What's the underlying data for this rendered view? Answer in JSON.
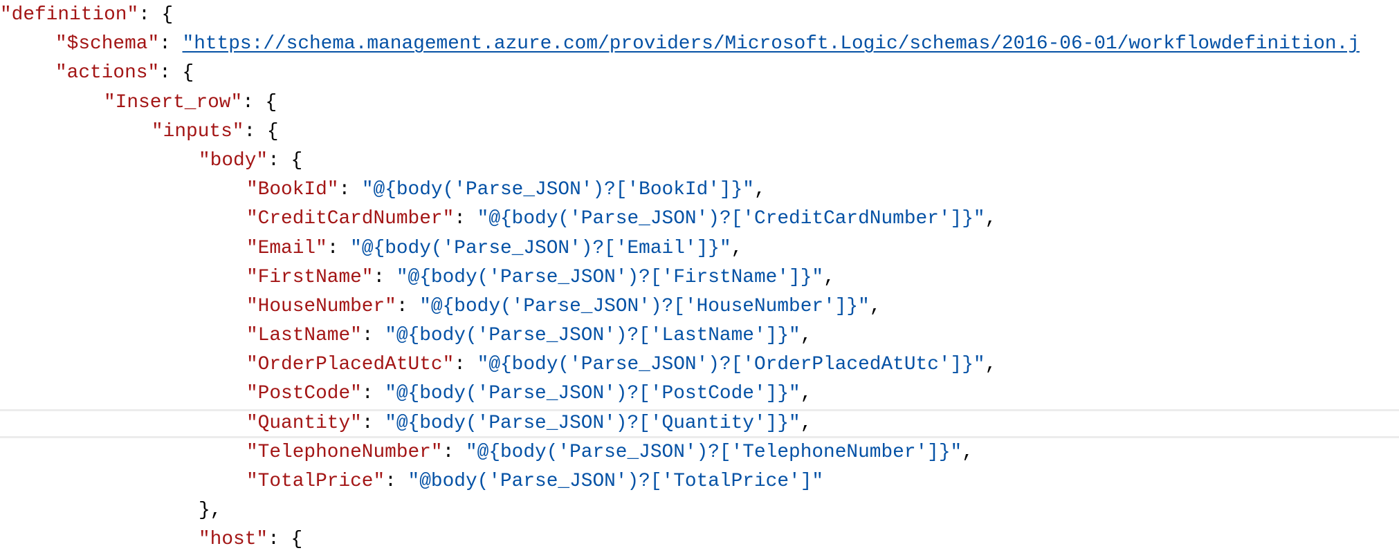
{
  "editor": {
    "colors": {
      "key": "#a31515",
      "string": "#0451a5",
      "punctuation": "#000000",
      "current_line": "#ececec"
    },
    "current_line_index": 14,
    "lines": [
      {
        "level": 0,
        "key": "\"definition\"",
        "sep": ": ",
        "value": "{",
        "value_type": "punct",
        "tail": ""
      },
      {
        "level": 1,
        "key": "\"$schema\"",
        "sep": ": ",
        "value": "\"https://schema.management.azure.com/providers/Microsoft.Logic/schemas/2016-06-01/workflowdefinition.j",
        "value_type": "link",
        "tail": ""
      },
      {
        "level": 1,
        "key": "\"actions\"",
        "sep": ": ",
        "value": "{",
        "value_type": "punct",
        "tail": ""
      },
      {
        "level": 2,
        "key": "\"Insert_row\"",
        "sep": ": ",
        "value": "{",
        "value_type": "punct",
        "tail": ""
      },
      {
        "level": 3,
        "key": "\"inputs\"",
        "sep": ": ",
        "value": "{",
        "value_type": "punct",
        "tail": ""
      },
      {
        "level": 4,
        "key": "\"body\"",
        "sep": ": ",
        "value": "{",
        "value_type": "punct",
        "tail": ""
      },
      {
        "level": 5,
        "key": "\"BookId\"",
        "sep": ": ",
        "value": "\"@{body('Parse_JSON')?['BookId']}\"",
        "value_type": "str",
        "tail": ","
      },
      {
        "level": 5,
        "key": "\"CreditCardNumber\"",
        "sep": ": ",
        "value": "\"@{body('Parse_JSON')?['CreditCardNumber']}\"",
        "value_type": "str",
        "tail": ","
      },
      {
        "level": 5,
        "key": "\"Email\"",
        "sep": ": ",
        "value": "\"@{body('Parse_JSON')?['Email']}\"",
        "value_type": "str",
        "tail": ","
      },
      {
        "level": 5,
        "key": "\"FirstName\"",
        "sep": ": ",
        "value": "\"@{body('Parse_JSON')?['FirstName']}\"",
        "value_type": "str",
        "tail": ","
      },
      {
        "level": 5,
        "key": "\"HouseNumber\"",
        "sep": ": ",
        "value": "\"@{body('Parse_JSON')?['HouseNumber']}\"",
        "value_type": "str",
        "tail": ","
      },
      {
        "level": 5,
        "key": "\"LastName\"",
        "sep": ": ",
        "value": "\"@{body('Parse_JSON')?['LastName']}\"",
        "value_type": "str",
        "tail": ","
      },
      {
        "level": 5,
        "key": "\"OrderPlacedAtUtc\"",
        "sep": ": ",
        "value": "\"@{body('Parse_JSON')?['OrderPlacedAtUtc']}\"",
        "value_type": "str",
        "tail": ","
      },
      {
        "level": 5,
        "key": "\"PostCode\"",
        "sep": ": ",
        "value": "\"@{body('Parse_JSON')?['PostCode']}\"",
        "value_type": "str",
        "tail": ","
      },
      {
        "level": 5,
        "key": "\"Quantity\"",
        "sep": ": ",
        "value": "\"@{body('Parse_JSON')?['Quantity']}\"",
        "value_type": "str",
        "tail": ","
      },
      {
        "level": 5,
        "key": "\"TelephoneNumber\"",
        "sep": ": ",
        "value": "\"@{body('Parse_JSON')?['TelephoneNumber']}\"",
        "value_type": "str",
        "tail": ","
      },
      {
        "level": 5,
        "key": "\"TotalPrice\"",
        "sep": ": ",
        "value": "\"@body('Parse_JSON')?['TotalPrice']\"",
        "value_type": "str",
        "tail": ""
      },
      {
        "level": 4,
        "key": "",
        "sep": "",
        "value": "},",
        "value_type": "punct",
        "tail": ""
      },
      {
        "level": 4,
        "key": "\"host\"",
        "sep": ": ",
        "value": "{",
        "value_type": "punct",
        "tail": ""
      }
    ]
  }
}
